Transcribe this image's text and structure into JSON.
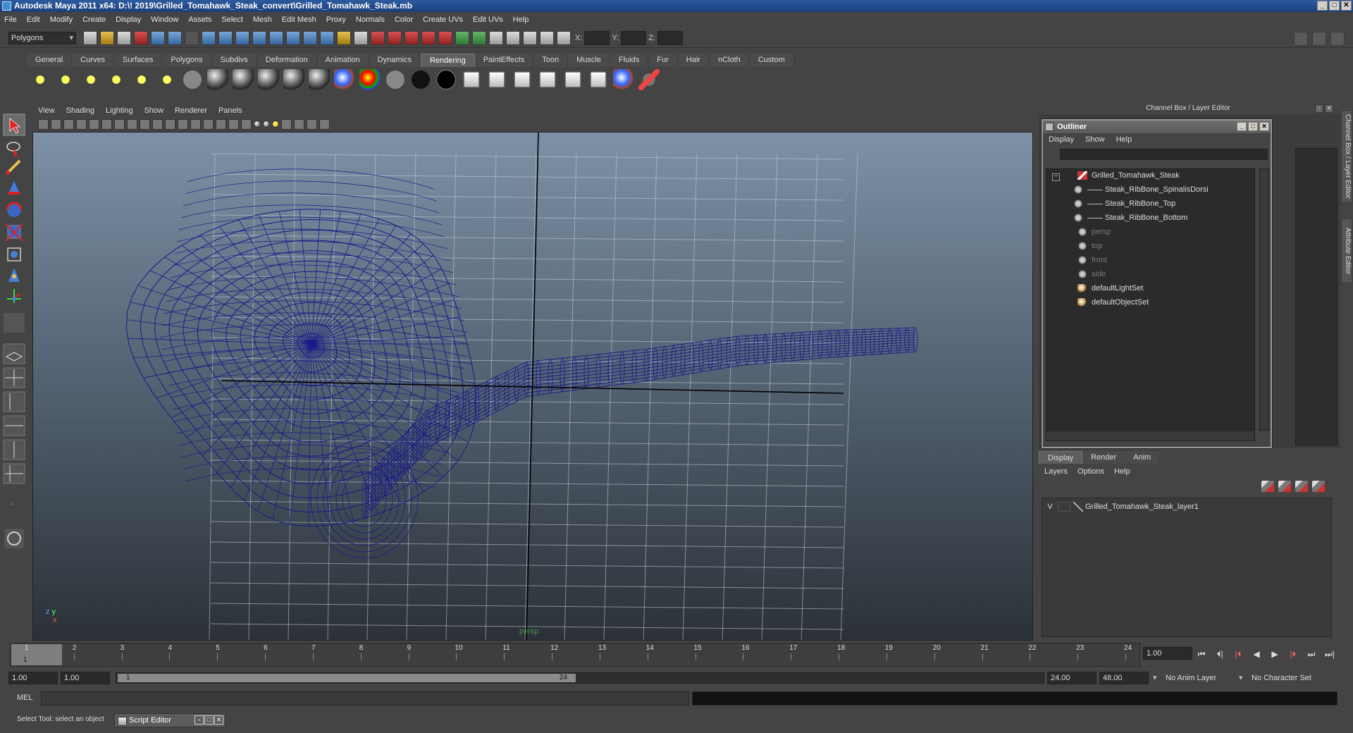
{
  "window": {
    "title": "Autodesk Maya 2011 x64: D:\\! 2019\\Grilled_Tomahawk_Steak_convert\\Grilled_Tomahawk_Steak.mb",
    "minimize": "_",
    "maximize": "□",
    "close": "✕"
  },
  "menubar": [
    "File",
    "Edit",
    "Modify",
    "Create",
    "Display",
    "Window",
    "Assets",
    "Select",
    "Mesh",
    "Edit Mesh",
    "Proxy",
    "Normals",
    "Color",
    "Create UVs",
    "Edit UVs",
    "Help"
  ],
  "statusline": {
    "mode": "Polygons",
    "x_label": "X:",
    "y_label": "Y:",
    "z_label": "Z:"
  },
  "shelf": {
    "tabs": [
      "General",
      "Curves",
      "Surfaces",
      "Polygons",
      "Subdivs",
      "Deformation",
      "Animation",
      "Dynamics",
      "Rendering",
      "PaintEffects",
      "Toon",
      "Muscle",
      "Fluids",
      "Fur",
      "Hair",
      "nCloth",
      "Custom"
    ],
    "active_tab": "Rendering",
    "icons": [
      "ambient-light-icon",
      "directional-light-icon",
      "point-light-icon",
      "spot-light-icon",
      "area-light-icon",
      "volume-light-icon",
      "render-sphere-icon",
      "blinn-sphere-icon",
      "lambert-sphere-icon",
      "phong-sphere-icon",
      "phonge-sphere-icon",
      "anisotropic-sphere-icon",
      "layered-shader-icon",
      "ramp-shader-icon",
      "surface-shader-icon",
      "black-shader-icon",
      "use-background-icon",
      "hypershade-icon",
      "render-view-icon",
      "render-settings-icon",
      "ipr-render-icon",
      "batch-render-icon",
      "mental-ray-icon",
      "toon-icon",
      "paint-icon"
    ]
  },
  "viewport": {
    "menu": [
      "View",
      "Shading",
      "Lighting",
      "Show",
      "Renderer",
      "Panels"
    ],
    "camera": "persp",
    "axis_x": "x",
    "axis_y": "y",
    "axis_z": "z"
  },
  "dock": {
    "title": "Channel Box / Layer Editor",
    "side_tabs": [
      "Channel Box / Layer Editor",
      "Attribute Editor"
    ]
  },
  "outliner": {
    "title": "Outliner",
    "menu": [
      "Display",
      "Show",
      "Help"
    ],
    "collapse_symbol": "−",
    "items": [
      {
        "label": "Grilled_Tomahawk_Steak",
        "indent": 0,
        "kind": "group",
        "dim": false
      },
      {
        "label": "Steak_RibBone_SpinalisDorsi",
        "indent": 1,
        "kind": "mesh",
        "dim": false
      },
      {
        "label": "Steak_RibBone_Top",
        "indent": 1,
        "kind": "mesh",
        "dim": false
      },
      {
        "label": "Steak_RibBone_Bottom",
        "indent": 1,
        "kind": "mesh",
        "dim": false
      },
      {
        "label": "persp",
        "indent": 0,
        "kind": "camera",
        "dim": true
      },
      {
        "label": "top",
        "indent": 0,
        "kind": "camera",
        "dim": true
      },
      {
        "label": "front",
        "indent": 0,
        "kind": "camera",
        "dim": true
      },
      {
        "label": "side",
        "indent": 0,
        "kind": "camera",
        "dim": true
      },
      {
        "label": "defaultLightSet",
        "indent": 0,
        "kind": "set",
        "dim": false
      },
      {
        "label": "defaultObjectSet",
        "indent": 0,
        "kind": "set",
        "dim": false
      }
    ]
  },
  "layer_editor": {
    "tabs": [
      "Display",
      "Render",
      "Anim"
    ],
    "active_tab": "Display",
    "menu": [
      "Layers",
      "Options",
      "Help"
    ],
    "layers": [
      {
        "visible": "V",
        "name": "Grilled_Tomahawk_Steak_layer1"
      }
    ]
  },
  "timeline": {
    "start": 1,
    "end": 24,
    "current_frame_label": "1",
    "frame_field": "1.00",
    "playback": [
      "⏮",
      "⏴|",
      "|⏴",
      "◀",
      "▶",
      "|⏵",
      "⏭",
      "⏭|"
    ]
  },
  "range": {
    "start_time": "1.00",
    "playback_start": "1.00",
    "range_start_label": "1",
    "range_end_label": "24",
    "playback_end": "24.00",
    "end_time": "48.00",
    "anim_layer": "No Anim Layer",
    "character_set": "No Character Set"
  },
  "command_line": {
    "label": "MEL"
  },
  "help_line": {
    "text": "Select Tool: select an object",
    "script_editor": "Script Editor"
  },
  "colors": {
    "wireframe": "#1a1a8a",
    "background_top": "#7d91a6",
    "background_bottom": "#2c3137",
    "accent_title": "#2d5a9e"
  }
}
